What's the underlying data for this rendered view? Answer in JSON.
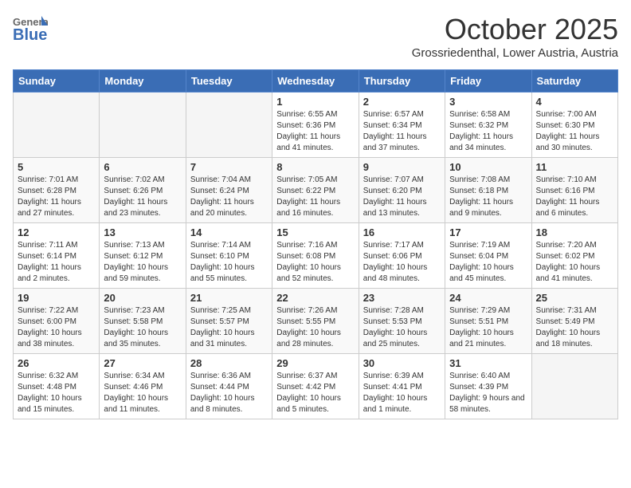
{
  "header": {
    "logo_general": "General",
    "logo_blue": "Blue",
    "month_title": "October 2025",
    "location": "Grossriedenthal, Lower Austria, Austria"
  },
  "weekdays": [
    "Sunday",
    "Monday",
    "Tuesday",
    "Wednesday",
    "Thursday",
    "Friday",
    "Saturday"
  ],
  "weeks": [
    [
      {
        "day": "",
        "empty": true
      },
      {
        "day": "",
        "empty": true
      },
      {
        "day": "",
        "empty": true
      },
      {
        "day": "1",
        "sunrise": "6:55 AM",
        "sunset": "6:36 PM",
        "daylight": "11 hours and 41 minutes."
      },
      {
        "day": "2",
        "sunrise": "6:57 AM",
        "sunset": "6:34 PM",
        "daylight": "11 hours and 37 minutes."
      },
      {
        "day": "3",
        "sunrise": "6:58 AM",
        "sunset": "6:32 PM",
        "daylight": "11 hours and 34 minutes."
      },
      {
        "day": "4",
        "sunrise": "7:00 AM",
        "sunset": "6:30 PM",
        "daylight": "11 hours and 30 minutes."
      }
    ],
    [
      {
        "day": "5",
        "sunrise": "7:01 AM",
        "sunset": "6:28 PM",
        "daylight": "11 hours and 27 minutes."
      },
      {
        "day": "6",
        "sunrise": "7:02 AM",
        "sunset": "6:26 PM",
        "daylight": "11 hours and 23 minutes."
      },
      {
        "day": "7",
        "sunrise": "7:04 AM",
        "sunset": "6:24 PM",
        "daylight": "11 hours and 20 minutes."
      },
      {
        "day": "8",
        "sunrise": "7:05 AM",
        "sunset": "6:22 PM",
        "daylight": "11 hours and 16 minutes."
      },
      {
        "day": "9",
        "sunrise": "7:07 AM",
        "sunset": "6:20 PM",
        "daylight": "11 hours and 13 minutes."
      },
      {
        "day": "10",
        "sunrise": "7:08 AM",
        "sunset": "6:18 PM",
        "daylight": "11 hours and 9 minutes."
      },
      {
        "day": "11",
        "sunrise": "7:10 AM",
        "sunset": "6:16 PM",
        "daylight": "11 hours and 6 minutes."
      }
    ],
    [
      {
        "day": "12",
        "sunrise": "7:11 AM",
        "sunset": "6:14 PM",
        "daylight": "11 hours and 2 minutes."
      },
      {
        "day": "13",
        "sunrise": "7:13 AM",
        "sunset": "6:12 PM",
        "daylight": "10 hours and 59 minutes."
      },
      {
        "day": "14",
        "sunrise": "7:14 AM",
        "sunset": "6:10 PM",
        "daylight": "10 hours and 55 minutes."
      },
      {
        "day": "15",
        "sunrise": "7:16 AM",
        "sunset": "6:08 PM",
        "daylight": "10 hours and 52 minutes."
      },
      {
        "day": "16",
        "sunrise": "7:17 AM",
        "sunset": "6:06 PM",
        "daylight": "10 hours and 48 minutes."
      },
      {
        "day": "17",
        "sunrise": "7:19 AM",
        "sunset": "6:04 PM",
        "daylight": "10 hours and 45 minutes."
      },
      {
        "day": "18",
        "sunrise": "7:20 AM",
        "sunset": "6:02 PM",
        "daylight": "10 hours and 41 minutes."
      }
    ],
    [
      {
        "day": "19",
        "sunrise": "7:22 AM",
        "sunset": "6:00 PM",
        "daylight": "10 hours and 38 minutes."
      },
      {
        "day": "20",
        "sunrise": "7:23 AM",
        "sunset": "5:58 PM",
        "daylight": "10 hours and 35 minutes."
      },
      {
        "day": "21",
        "sunrise": "7:25 AM",
        "sunset": "5:57 PM",
        "daylight": "10 hours and 31 minutes."
      },
      {
        "day": "22",
        "sunrise": "7:26 AM",
        "sunset": "5:55 PM",
        "daylight": "10 hours and 28 minutes."
      },
      {
        "day": "23",
        "sunrise": "7:28 AM",
        "sunset": "5:53 PM",
        "daylight": "10 hours and 25 minutes."
      },
      {
        "day": "24",
        "sunrise": "7:29 AM",
        "sunset": "5:51 PM",
        "daylight": "10 hours and 21 minutes."
      },
      {
        "day": "25",
        "sunrise": "7:31 AM",
        "sunset": "5:49 PM",
        "daylight": "10 hours and 18 minutes."
      }
    ],
    [
      {
        "day": "26",
        "sunrise": "6:32 AM",
        "sunset": "4:48 PM",
        "daylight": "10 hours and 15 minutes."
      },
      {
        "day": "27",
        "sunrise": "6:34 AM",
        "sunset": "4:46 PM",
        "daylight": "10 hours and 11 minutes."
      },
      {
        "day": "28",
        "sunrise": "6:36 AM",
        "sunset": "4:44 PM",
        "daylight": "10 hours and 8 minutes."
      },
      {
        "day": "29",
        "sunrise": "6:37 AM",
        "sunset": "4:42 PM",
        "daylight": "10 hours and 5 minutes."
      },
      {
        "day": "30",
        "sunrise": "6:39 AM",
        "sunset": "4:41 PM",
        "daylight": "10 hours and 1 minute."
      },
      {
        "day": "31",
        "sunrise": "6:40 AM",
        "sunset": "4:39 PM",
        "daylight": "9 hours and 58 minutes."
      },
      {
        "day": "",
        "empty": true
      }
    ]
  ]
}
